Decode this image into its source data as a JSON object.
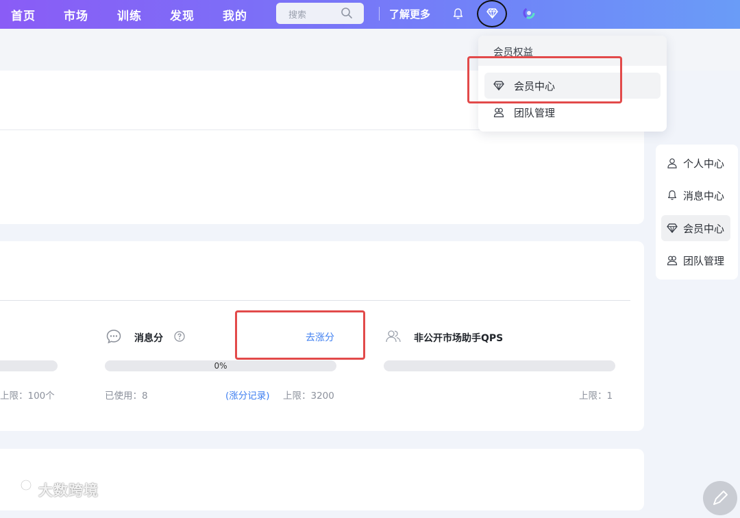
{
  "nav": {
    "items": [
      "首页",
      "市场",
      "训练",
      "发现",
      "我的"
    ],
    "search_placeholder": "搜索",
    "learn_more": "了解更多"
  },
  "dropdown": {
    "header": "会员权益",
    "items": [
      {
        "label": "会员中心",
        "icon": "diamond-icon",
        "active": true
      },
      {
        "label": "团队管理",
        "icon": "team-icon",
        "active": false
      }
    ]
  },
  "side_menu": {
    "items": [
      {
        "label": "个人中心",
        "icon": "user-icon"
      },
      {
        "label": "消息中心",
        "icon": "bell-icon"
      },
      {
        "label": "会员中心",
        "icon": "diamond-icon"
      },
      {
        "label": "团队管理",
        "icon": "team-icon"
      }
    ]
  },
  "quota": {
    "left_limit": "上限：100个",
    "message_score": {
      "title": "消息分",
      "action": "去涨分",
      "percent": "0%",
      "used": "已使用：8",
      "history_link": "(涨分记录)",
      "limit": "上限：3200"
    },
    "qps": {
      "title": "非公开市场助手QPS",
      "limit": "上限：1"
    }
  },
  "watermark": "大数跨境",
  "colors": {
    "nav_gradient_start": "#8a5cf6",
    "nav_gradient_end": "#6a9cf7",
    "link": "#3f7ff0",
    "highlight": "#e24a4a"
  }
}
